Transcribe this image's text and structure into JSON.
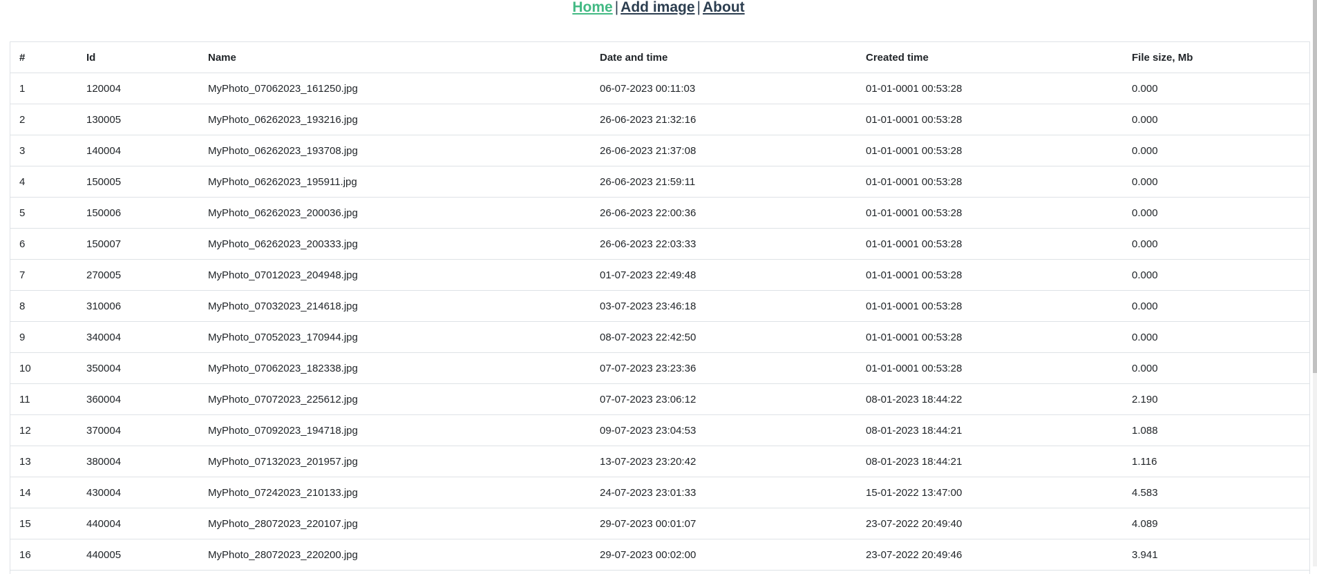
{
  "nav": {
    "home_label": "Home",
    "add_image_label": "Add image",
    "about_label": "About",
    "separator": "|"
  },
  "table": {
    "headers": [
      "#",
      "Id",
      "Name",
      "Date and time",
      "Created time",
      "File size, Mb"
    ],
    "rows": [
      [
        "1",
        "120004",
        "MyPhoto_07062023_161250.jpg",
        "06-07-2023 00:11:03",
        "01-01-0001 00:53:28",
        "0.000"
      ],
      [
        "2",
        "130005",
        "MyPhoto_06262023_193216.jpg",
        "26-06-2023 21:32:16",
        "01-01-0001 00:53:28",
        "0.000"
      ],
      [
        "3",
        "140004",
        "MyPhoto_06262023_193708.jpg",
        "26-06-2023 21:37:08",
        "01-01-0001 00:53:28",
        "0.000"
      ],
      [
        "4",
        "150005",
        "MyPhoto_06262023_195911.jpg",
        "26-06-2023 21:59:11",
        "01-01-0001 00:53:28",
        "0.000"
      ],
      [
        "5",
        "150006",
        "MyPhoto_06262023_200036.jpg",
        "26-06-2023 22:00:36",
        "01-01-0001 00:53:28",
        "0.000"
      ],
      [
        "6",
        "150007",
        "MyPhoto_06262023_200333.jpg",
        "26-06-2023 22:03:33",
        "01-01-0001 00:53:28",
        "0.000"
      ],
      [
        "7",
        "270005",
        "MyPhoto_07012023_204948.jpg",
        "01-07-2023 22:49:48",
        "01-01-0001 00:53:28",
        "0.000"
      ],
      [
        "8",
        "310006",
        "MyPhoto_07032023_214618.jpg",
        "03-07-2023 23:46:18",
        "01-01-0001 00:53:28",
        "0.000"
      ],
      [
        "9",
        "340004",
        "MyPhoto_07052023_170944.jpg",
        "08-07-2023 22:42:50",
        "01-01-0001 00:53:28",
        "0.000"
      ],
      [
        "10",
        "350004",
        "MyPhoto_07062023_182338.jpg",
        "07-07-2023 23:23:36",
        "01-01-0001 00:53:28",
        "0.000"
      ],
      [
        "11",
        "360004",
        "MyPhoto_07072023_225612.jpg",
        "07-07-2023 23:06:12",
        "08-01-2023 18:44:22",
        "2.190"
      ],
      [
        "12",
        "370004",
        "MyPhoto_07092023_194718.jpg",
        "09-07-2023 23:04:53",
        "08-01-2023 18:44:21",
        "1.088"
      ],
      [
        "13",
        "380004",
        "MyPhoto_07132023_201957.jpg",
        "13-07-2023 23:20:42",
        "08-01-2023 18:44:21",
        "1.116"
      ],
      [
        "14",
        "430004",
        "MyPhoto_07242023_210133.jpg",
        "24-07-2023 23:01:33",
        "15-01-2022 13:47:00",
        "4.583"
      ],
      [
        "15",
        "440004",
        "MyPhoto_28072023_220107.jpg",
        "29-07-2023 00:01:07",
        "23-07-2022 20:49:40",
        "4.089"
      ],
      [
        "16",
        "440005",
        "MyPhoto_28072023_220200.jpg",
        "29-07-2023 00:02:00",
        "23-07-2022 20:49:46",
        "3.941"
      ]
    ]
  }
}
